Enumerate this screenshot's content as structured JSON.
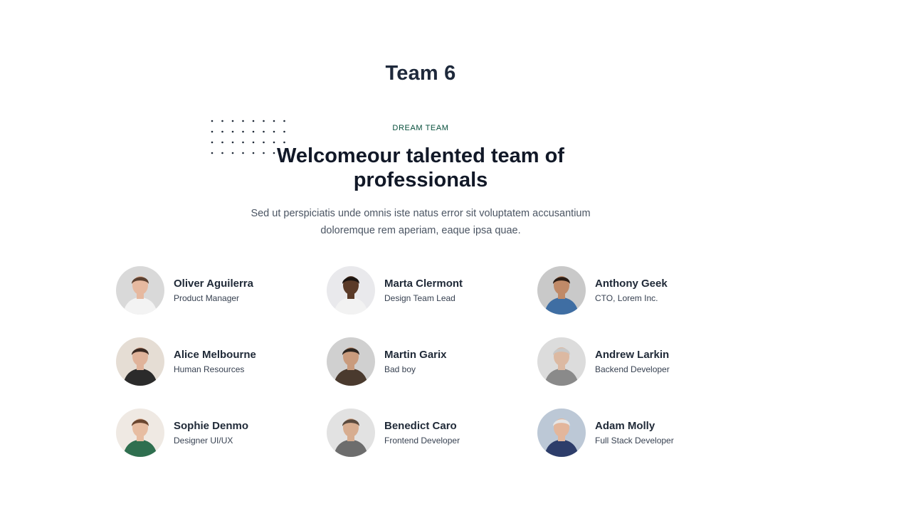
{
  "page": {
    "title": "Team 6"
  },
  "section": {
    "eyebrow": "DREAM TEAM",
    "headline_line1": "Welcomeour talented team of",
    "headline_line2": "professionals",
    "subtext_line1": "Sed ut perspiciatis unde omnis iste natus error sit voluptatem accusantium",
    "subtext_line2": "doloremque rem aperiam, eaque ipsa quae."
  },
  "team": [
    {
      "name": "Oliver Aguilerra",
      "role": "Product Manager",
      "avatar": {
        "bg": "#d9d9d9",
        "skin": "#e6b9a0",
        "hair": "#5b4030",
        "shirt": "#f3f3f3"
      }
    },
    {
      "name": "Marta Clermont",
      "role": "Design Team Lead",
      "avatar": {
        "bg": "#e9e9ec",
        "skin": "#5a3a28",
        "hair": "#1b1410",
        "shirt": "#f2f2f2"
      }
    },
    {
      "name": "Anthony Geek",
      "role": "CTO, Lorem Inc.",
      "avatar": {
        "bg": "#c9c9c9",
        "skin": "#c08a68",
        "hair": "#2a1c14",
        "shirt": "#3f6ea3"
      }
    },
    {
      "name": "Alice Melbourne",
      "role": "Human Resources",
      "avatar": {
        "bg": "#e5ddd4",
        "skin": "#e0b39a",
        "hair": "#3b2a22",
        "shirt": "#2b2b2b"
      }
    },
    {
      "name": "Martin Garix",
      "role": "Bad boy",
      "avatar": {
        "bg": "#d0d0d0",
        "skin": "#c99b7d",
        "hair": "#2e2620",
        "shirt": "#4a3a2e"
      }
    },
    {
      "name": "Andrew Larkin",
      "role": "Backend Developer",
      "avatar": {
        "bg": "#dcdcdc",
        "skin": "#dcb9a2",
        "hair": "#c8c8c8",
        "shirt": "#8a8a8a"
      }
    },
    {
      "name": "Sophie Denmo",
      "role": "Designer UI/UX",
      "avatar": {
        "bg": "#efe9e3",
        "skin": "#e7bda2",
        "hair": "#6a4630",
        "shirt": "#2f6f4f"
      }
    },
    {
      "name": "Benedict Caro",
      "role": "Frontend Developer",
      "avatar": {
        "bg": "#e2e2e2",
        "skin": "#d7ad90",
        "hair": "#5a4a3e",
        "shirt": "#6d6d6d"
      }
    },
    {
      "name": "Adam Molly",
      "role": "Full Stack Developer",
      "avatar": {
        "bg": "#bcc8d6",
        "skin": "#e3b69b",
        "hair": "#e6e6e6",
        "shirt": "#2d3d6a"
      }
    }
  ],
  "colors": {
    "eyebrow": "#064e3b",
    "heading": "#111827",
    "body_text": "#4b5563",
    "dots": "#1f2937"
  }
}
